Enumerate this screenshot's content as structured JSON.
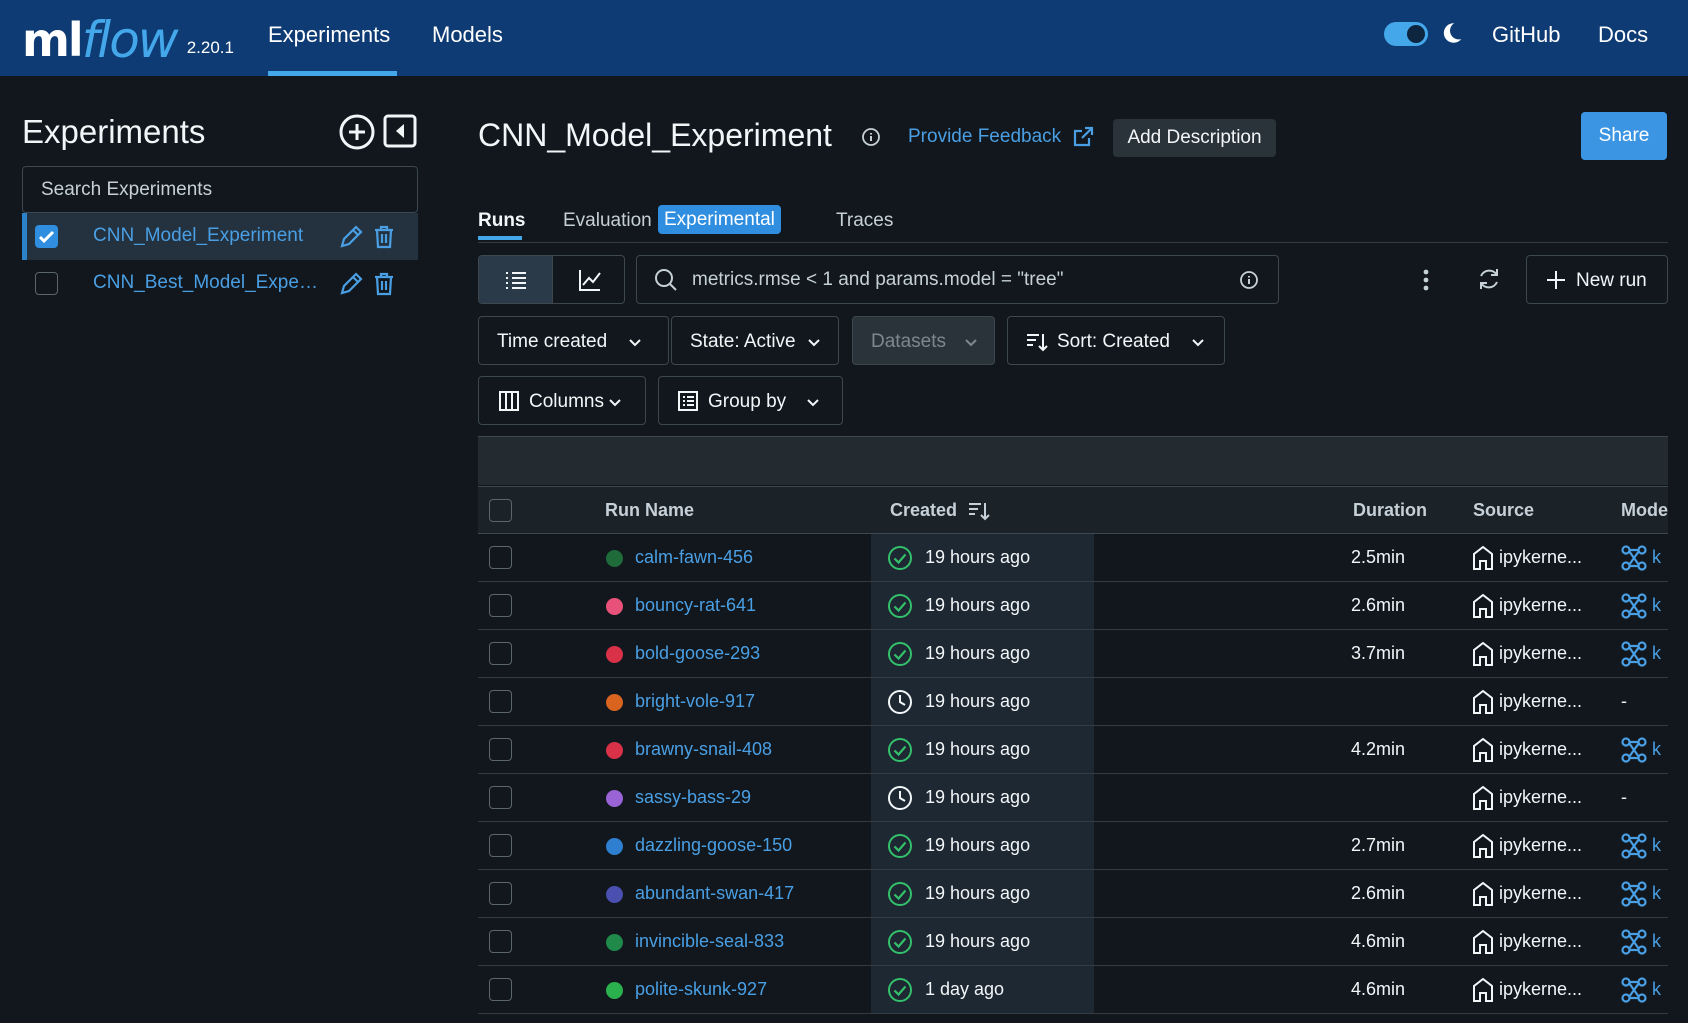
{
  "header": {
    "logo_ml": "ml",
    "logo_flow": "flow",
    "version": "2.20.1",
    "nav": [
      "Experiments",
      "Models"
    ],
    "links": [
      "GitHub",
      "Docs"
    ],
    "accent": "#43a7ea",
    "bar_color": "#0e3b73"
  },
  "sidebar": {
    "title": "Experiments",
    "search_placeholder": "Search Experiments",
    "experiments": [
      {
        "name": "CNN_Model_Experiment",
        "checked": true
      },
      {
        "name": "CNN_Best_Model_Experi...",
        "checked": false
      }
    ]
  },
  "main": {
    "title": "CNN_Model_Experiment",
    "feedback": "Provide Feedback",
    "add_description": "Add Description",
    "share": "Share",
    "tabs": {
      "runs": "Runs",
      "evaluation": "Evaluation",
      "experimental_badge": "Experimental",
      "traces": "Traces"
    },
    "search_query": "metrics.rmse < 1 and params.model = \"tree\"",
    "new_run": "New run",
    "filters": {
      "time_created": "Time created",
      "state": "State: Active",
      "datasets": "Datasets",
      "sort": "Sort: Created",
      "columns": "Columns",
      "group_by": "Group by"
    }
  },
  "table": {
    "columns": {
      "run_name": "Run Name",
      "created": "Created",
      "duration": "Duration",
      "source": "Source",
      "models": "Mode"
    },
    "rows": [
      {
        "name": "calm-fawn-456",
        "color": "#1f6b3a",
        "status": "finished",
        "created": "19 hours ago",
        "duration": "2.5min",
        "source": "ipykerne...",
        "model": "k"
      },
      {
        "name": "bouncy-rat-641",
        "color": "#e8527a",
        "status": "finished",
        "created": "19 hours ago",
        "duration": "2.6min",
        "source": "ipykerne...",
        "model": "k"
      },
      {
        "name": "bold-goose-293",
        "color": "#d93148",
        "status": "finished",
        "created": "19 hours ago",
        "duration": "3.7min",
        "source": "ipykerne...",
        "model": "k"
      },
      {
        "name": "bright-vole-917",
        "color": "#d8641f",
        "status": "running",
        "created": "19 hours ago",
        "duration": "",
        "source": "ipykerne...",
        "model": "-"
      },
      {
        "name": "brawny-snail-408",
        "color": "#d93148",
        "status": "finished",
        "created": "19 hours ago",
        "duration": "4.2min",
        "source": "ipykerne...",
        "model": "k"
      },
      {
        "name": "sassy-bass-29",
        "color": "#9a64d6",
        "status": "running",
        "created": "19 hours ago",
        "duration": "",
        "source": "ipykerne...",
        "model": "-"
      },
      {
        "name": "dazzling-goose-150",
        "color": "#2f7fd0",
        "status": "finished",
        "created": "19 hours ago",
        "duration": "2.7min",
        "source": "ipykerne...",
        "model": "k"
      },
      {
        "name": "abundant-swan-417",
        "color": "#4a4fb0",
        "status": "finished",
        "created": "19 hours ago",
        "duration": "2.6min",
        "source": "ipykerne...",
        "model": "k"
      },
      {
        "name": "invincible-seal-833",
        "color": "#1f8a4a",
        "status": "finished",
        "created": "19 hours ago",
        "duration": "4.6min",
        "source": "ipykerne...",
        "model": "k"
      },
      {
        "name": "polite-skunk-927",
        "color": "#2bb04e",
        "status": "finished",
        "created": "1 day ago",
        "duration": "4.6min",
        "source": "ipykerne...",
        "model": "k"
      }
    ]
  }
}
